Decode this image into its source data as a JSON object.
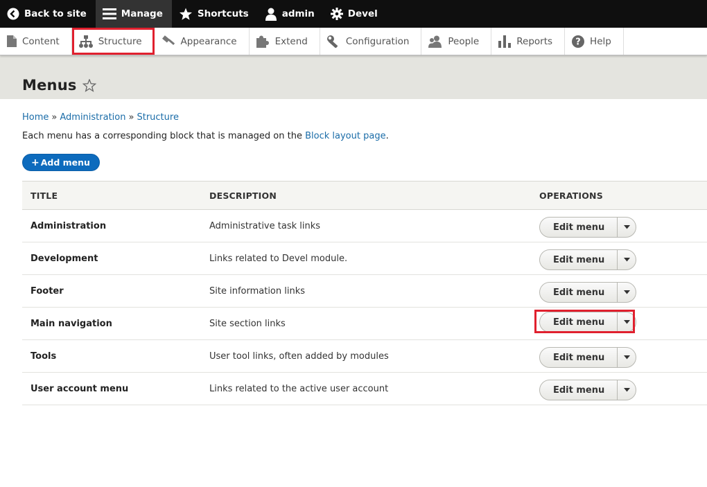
{
  "toolbar": {
    "items": [
      {
        "label": "Back to site",
        "icon": "back-circle-icon"
      },
      {
        "label": "Manage",
        "icon": "hamburger-icon",
        "active": true
      },
      {
        "label": "Shortcuts",
        "icon": "star-icon"
      },
      {
        "label": "admin",
        "icon": "user-icon"
      },
      {
        "label": "Devel",
        "icon": "gear-icon"
      }
    ]
  },
  "tray": {
    "items": [
      {
        "label": "Content",
        "icon": "file-icon"
      },
      {
        "label": "Structure",
        "icon": "sitemap-icon",
        "highlighted": true
      },
      {
        "label": "Appearance",
        "icon": "paintbrush-icon"
      },
      {
        "label": "Extend",
        "icon": "puzzle-icon"
      },
      {
        "label": "Configuration",
        "icon": "wrench-icon"
      },
      {
        "label": "People",
        "icon": "people-icon"
      },
      {
        "label": "Reports",
        "icon": "bar-chart-icon"
      },
      {
        "label": "Help",
        "icon": "help-icon"
      }
    ]
  },
  "page": {
    "title": "Menus",
    "breadcrumb": [
      "Home",
      "Administration",
      "Structure"
    ],
    "breadcrumb_sep": "»",
    "desc_before": "Each menu has a corresponding block that is managed on the ",
    "desc_link": "Block layout page",
    "desc_after": ".",
    "add_button": "Add menu",
    "add_plus": "+"
  },
  "table": {
    "headers": {
      "title": "TITLE",
      "description": "DESCRIPTION",
      "operations": "OPERATIONS"
    },
    "rows": [
      {
        "title": "Administration",
        "description": "Administrative task links",
        "op": "Edit menu"
      },
      {
        "title": "Development",
        "description": "Links related to Devel module.",
        "op": "Edit menu"
      },
      {
        "title": "Footer",
        "description": "Site information links",
        "op": "Edit menu"
      },
      {
        "title": "Main navigation",
        "description": "Site section links",
        "op": "Edit menu",
        "highlighted": true
      },
      {
        "title": "Tools",
        "description": "User tool links, often added by modules",
        "op": "Edit menu"
      },
      {
        "title": "User account menu",
        "description": "Links related to the active user account",
        "op": "Edit menu"
      }
    ]
  },
  "colors": {
    "accent": "#0d6bbd",
    "link": "#1a6ca8",
    "highlight": "#e0202e",
    "toolbar_bg": "#0f0f0f",
    "header_bg": "#e4e4df"
  }
}
